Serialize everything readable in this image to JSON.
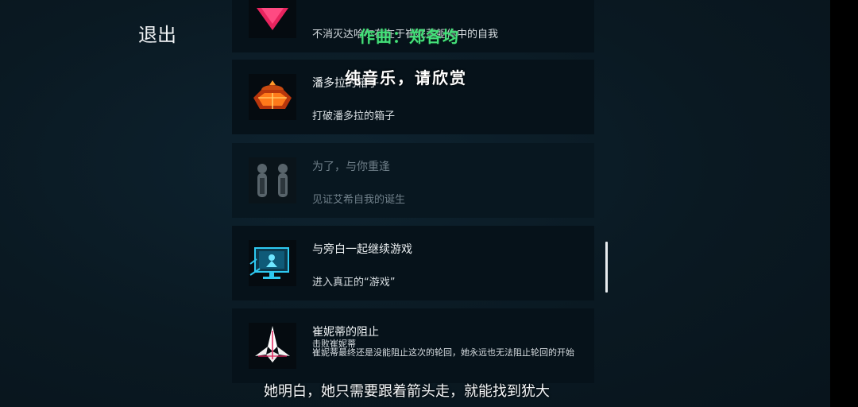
{
  "exit_label": "退出",
  "achievements": [
    {
      "title": "",
      "desc": "不消灭达哈尔存在于崔妮蒂躯体中的自我",
      "icon": "pink-heart-icon",
      "locked": false
    },
    {
      "title": "潘多拉的箱子",
      "desc": "打破潘多拉的箱子",
      "icon": "pandora-box-icon",
      "locked": false
    },
    {
      "title": "为了，与你重逢",
      "desc": "见证艾希自我的诞生",
      "icon": "twin-figures-icon",
      "locked": true
    },
    {
      "title": "与旁白一起继续游戏",
      "desc": "进入真正的“游戏”",
      "icon": "holo-monitor-icon",
      "locked": false
    },
    {
      "title": "崔妮蒂的阻止",
      "desc": "击败崔妮蒂\n崔妮蒂最终还是没能阻止这次的轮回，她永远也无法阻止轮回的开始",
      "icon": "white-ship-icon",
      "locked": false
    }
  ],
  "overlay": {
    "credit": "作曲：郑各均",
    "music": "纯音乐，请欣赏"
  },
  "subtitle": "她明白，她只需要跟着箭头走，就能找到犹大",
  "colors": {
    "background": "#0b1a24",
    "card": "#06121a",
    "credit_green": "#44e07a",
    "heart_pink": "#e8245e"
  }
}
